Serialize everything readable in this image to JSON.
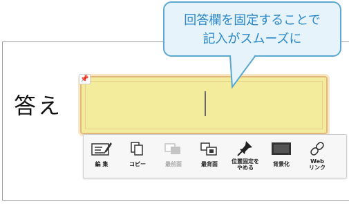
{
  "callout": {
    "line1": "回答欄を固定することで",
    "line2": "記入がスムーズに"
  },
  "answer": {
    "label": "答え"
  },
  "toolbar": {
    "edit": "編 集",
    "copy": "コピー",
    "front": "最前面",
    "back": "最背面",
    "unpin": "位置固定を\nやめる",
    "background": "背景化",
    "weblink": "Web\nリンク"
  },
  "icons": {
    "edit": "edit-icon",
    "copy": "copy-icon",
    "front": "bring-front-icon",
    "back": "send-back-icon",
    "unpin": "pin-icon",
    "background": "background-icon",
    "weblink": "link-icon",
    "pin_marker": "pin-marker-icon"
  },
  "colors": {
    "answer_fill": "#f2ec9c",
    "answer_border": "#e3b77a",
    "callout_fill": "#e6f3fa",
    "callout_border": "#5aa7cf",
    "callout_text": "#2b88c8"
  }
}
